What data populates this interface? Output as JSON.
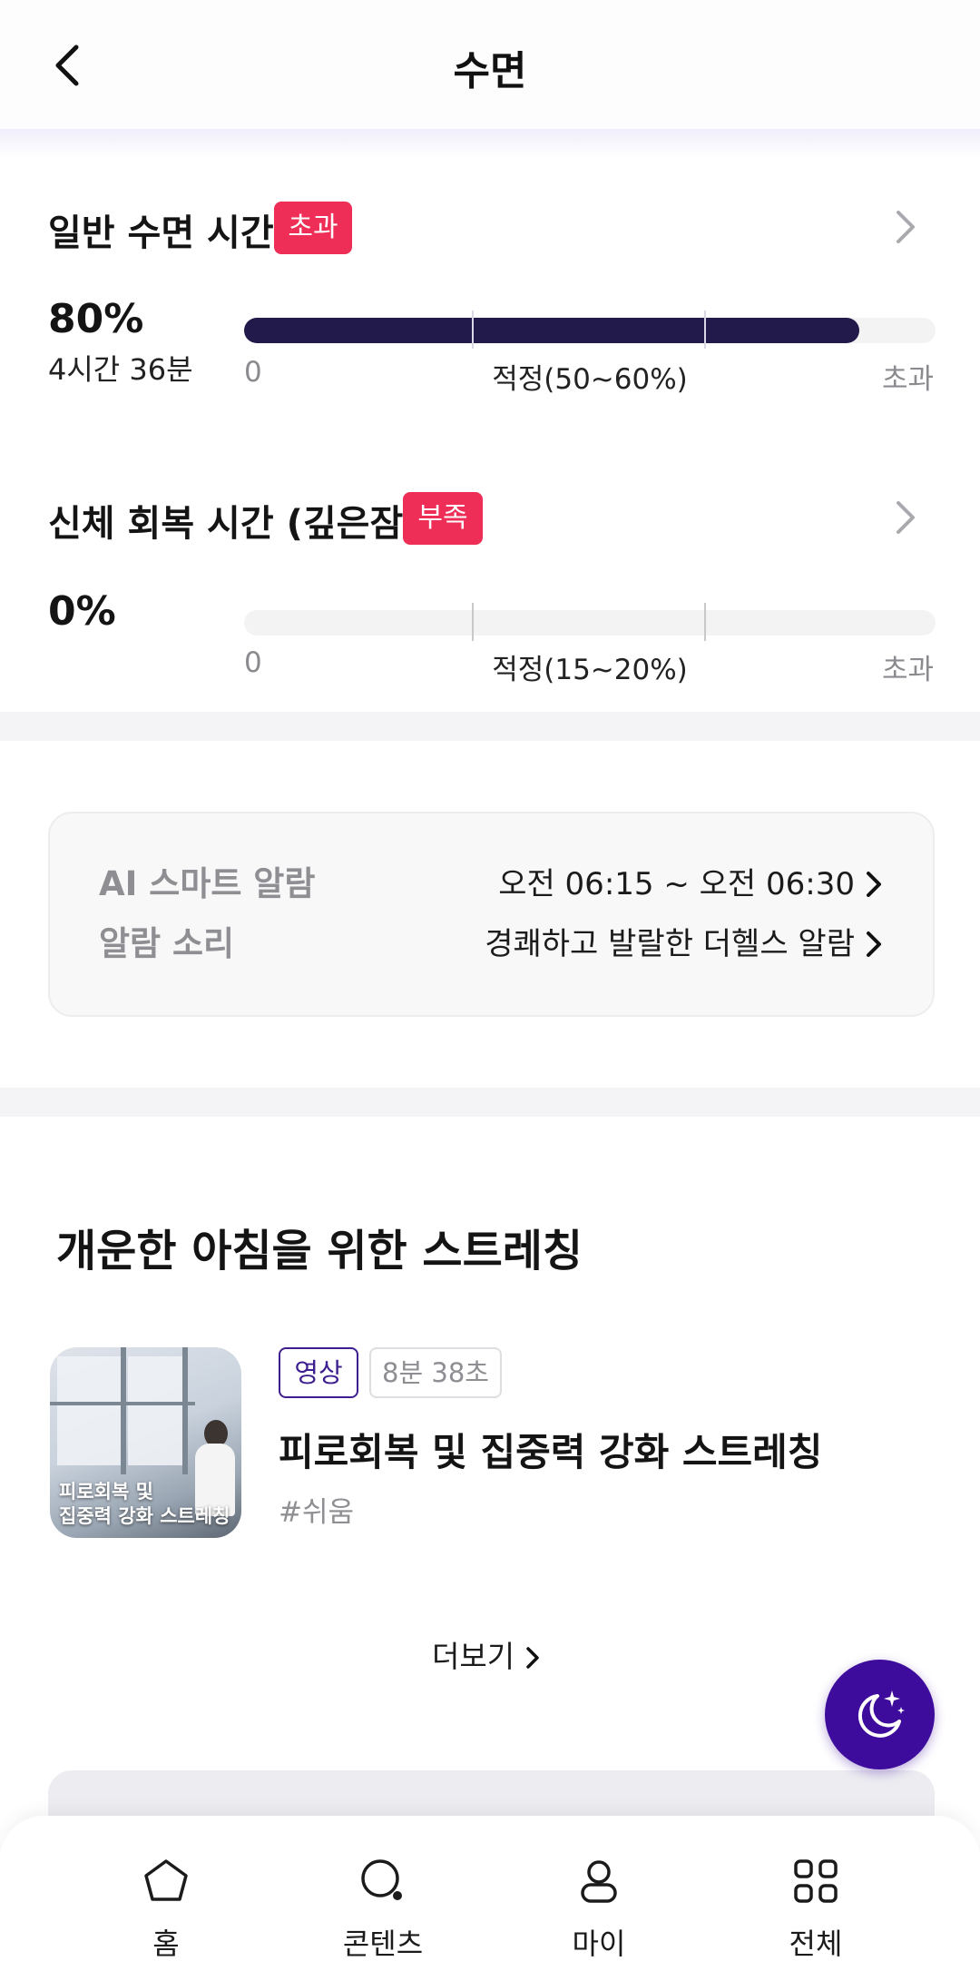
{
  "header": {
    "title": "수면"
  },
  "metrics": [
    {
      "title": "일반 수면 시간",
      "badge": "초과",
      "percent": "80%",
      "duration": "4시간 36분",
      "fill_fraction": 0.89,
      "scale_start": "0",
      "scale_mid": "적정(50~60%)",
      "scale_end": "초과"
    },
    {
      "title": "신체 회복 시간 (깊은잠)",
      "badge": "부족",
      "percent": "0%",
      "fill_fraction": 0,
      "scale_start": "0",
      "scale_mid": "적정(15~20%)",
      "scale_end": "초과"
    }
  ],
  "alarm": {
    "smart_label": "AI 스마트 알람",
    "smart_value": "오전 06:15 ~ 오전 06:30",
    "sound_label": "알람 소리",
    "sound_value": "경쾌하고 발랄한 더헬스 알람"
  },
  "stretching": {
    "section_title": "개운한 아침을 위한 스트레칭",
    "video": {
      "thumbnail_caption_line1": "피로회복 및",
      "thumbnail_caption_line2": "집중력 강화 스트레칭",
      "tag_type": "영상",
      "duration": "8분 38초",
      "title": "피로회복 및 집중력 강화 스트레칭",
      "hashtag": "#쉬움"
    },
    "more_label": "더보기"
  },
  "bottom_nav": [
    {
      "label": "홈",
      "icon": "home-icon"
    },
    {
      "label": "콘텐츠",
      "icon": "search-icon"
    },
    {
      "label": "마이",
      "icon": "person-icon"
    },
    {
      "label": "전체",
      "icon": "grid-icon"
    }
  ],
  "colors": {
    "badge_red": "#ee2e57",
    "bar_fill": "#221a4a",
    "accent_purple": "#3d0c9c"
  }
}
